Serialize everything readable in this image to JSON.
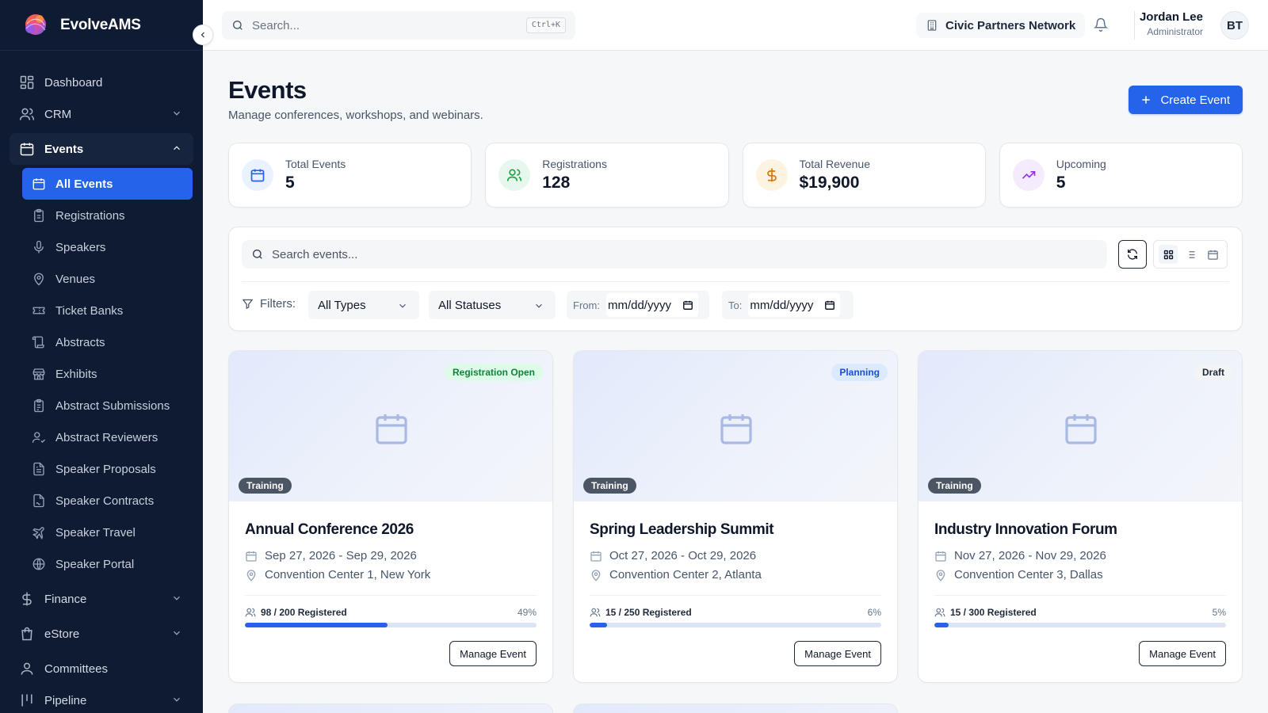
{
  "app": {
    "name": "EvolveAMS"
  },
  "sidebar": {
    "top_items": [
      {
        "label": "Dashboard",
        "icon": "dashboard-icon"
      },
      {
        "label": "CRM",
        "icon": "users-icon",
        "expandable": true
      }
    ],
    "events_group": {
      "label": "Events",
      "icon": "calendar-icon",
      "expanded": true,
      "items": [
        {
          "label": "All Events",
          "icon": "calendar-grid-icon",
          "active": true
        },
        {
          "label": "Registrations",
          "icon": "clipboard-icon"
        },
        {
          "label": "Speakers",
          "icon": "mic-icon"
        },
        {
          "label": "Venues",
          "icon": "map-pin-icon"
        },
        {
          "label": "Ticket Banks",
          "icon": "ticket-icon"
        },
        {
          "label": "Abstracts",
          "icon": "scroll-icon"
        },
        {
          "label": "Exhibits",
          "icon": "store-icon"
        },
        {
          "label": "Abstract Submissions",
          "icon": "clipboard-list-icon"
        },
        {
          "label": "Abstract Reviewers",
          "icon": "user-check-icon"
        },
        {
          "label": "Speaker Proposals",
          "icon": "file-text-icon"
        },
        {
          "label": "Speaker Contracts",
          "icon": "file-signature-icon"
        },
        {
          "label": "Speaker Travel",
          "icon": "plane-icon"
        },
        {
          "label": "Speaker Portal",
          "icon": "globe-icon"
        }
      ]
    },
    "bottom_items": [
      {
        "label": "Finance",
        "icon": "dollar-icon",
        "expandable": true
      },
      {
        "label": "eStore",
        "icon": "shopping-bag-icon",
        "expandable": true
      },
      {
        "label": "Committees",
        "icon": "user-icon",
        "expandable": false
      },
      {
        "label": "Pipeline",
        "icon": "kanban-icon",
        "expandable": true
      }
    ]
  },
  "topbar": {
    "search_placeholder": "Search...",
    "shortcut": "Ctrl+K",
    "org_name": "Civic Partners Network",
    "user_name": "Jordan Lee",
    "user_role": "Administrator",
    "avatar_initials": "BT"
  },
  "page": {
    "title": "Events",
    "subtitle": "Manage conferences, workshops, and webinars.",
    "create_label": "Create Event"
  },
  "stats": [
    {
      "label": "Total Events",
      "value": "5",
      "icon": "calendar-icon",
      "color": "#2563eb",
      "bg": "#eaf1ff"
    },
    {
      "label": "Registrations",
      "value": "128",
      "icon": "users-icon",
      "color": "#16a34a",
      "bg": "#e8f7ee"
    },
    {
      "label": "Total Revenue",
      "value": "$19,900",
      "icon": "dollar-icon",
      "color": "#d97706",
      "bg": "#fdf3e1"
    },
    {
      "label": "Upcoming",
      "value": "5",
      "icon": "trending-up-icon",
      "color": "#9333ea",
      "bg": "#f4ebfd"
    }
  ],
  "filters": {
    "search_placeholder": "Search events...",
    "label": "Filters:",
    "type_select": "All Types",
    "status_select": "All Statuses",
    "from_label": "From:",
    "from_value": "mm/dd/yyyy",
    "to_label": "To:",
    "to_value": "mm/dd/yyyy",
    "view_active": "grid"
  },
  "events": [
    {
      "title": "Annual Conference 2026",
      "status": "Registration Open",
      "status_color": "#15803d",
      "status_bg": "#dcfce7",
      "type": "Training",
      "dates": "Sep 27, 2026 - Sep 29, 2026",
      "location": "Convention Center 1, New York",
      "registered_text": "98 / 200 Registered",
      "percent_text": "49%",
      "progress": 0.49,
      "action": "Manage Event"
    },
    {
      "title": "Spring Leadership Summit",
      "status": "Planning",
      "status_color": "#1d4ed8",
      "status_bg": "#dbeafe",
      "type": "Training",
      "dates": "Oct 27, 2026 - Oct 29, 2026",
      "location": "Convention Center 2, Atlanta",
      "registered_text": "15 / 250 Registered",
      "percent_text": "6%",
      "progress": 0.06,
      "action": "Manage Event"
    },
    {
      "title": "Industry Innovation Forum",
      "status": "Draft",
      "status_color": "#1f2937",
      "status_bg": "#f3f4f6",
      "type": "Training",
      "dates": "Nov 27, 2026 - Nov 29, 2026",
      "location": "Convention Center 3, Dallas",
      "registered_text": "15 / 300 Registered",
      "percent_text": "5%",
      "progress": 0.05,
      "action": "Manage Event"
    }
  ]
}
